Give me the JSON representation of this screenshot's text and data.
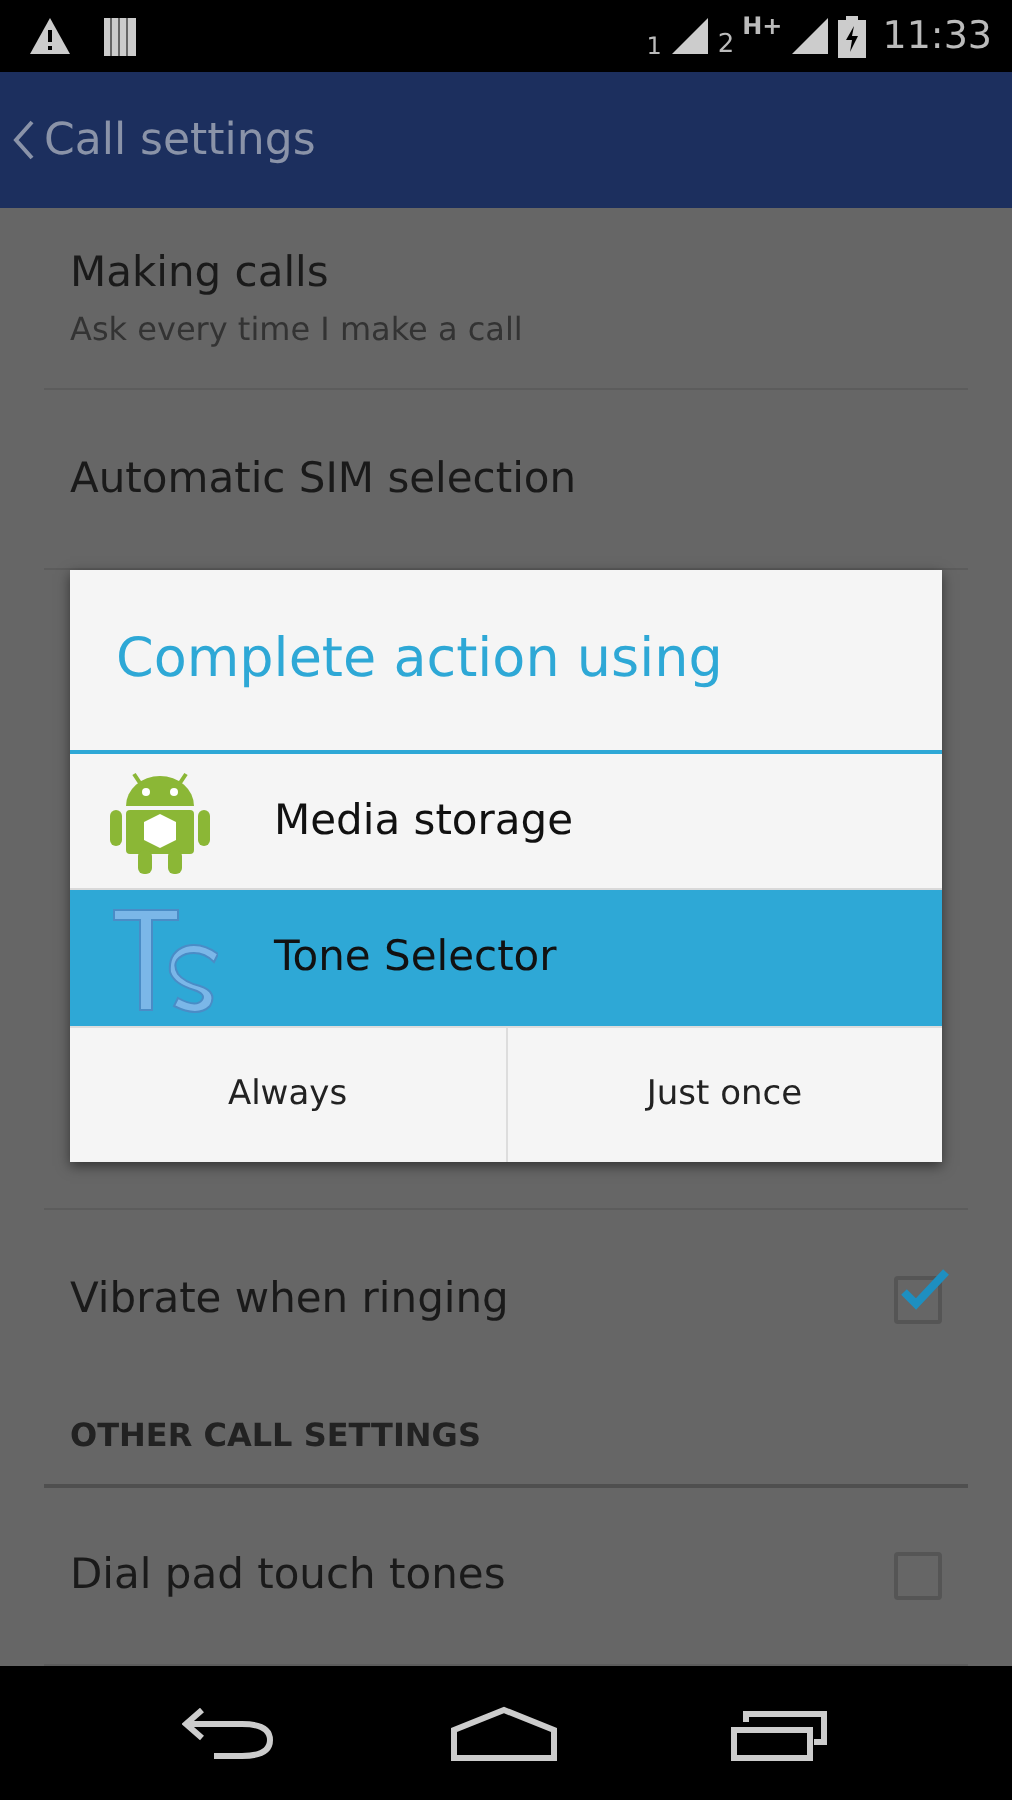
{
  "status_bar": {
    "sim1_label": "1",
    "sim2_label": "2",
    "network_type": "H+",
    "time": "11:33"
  },
  "app_bar": {
    "title": "Call settings"
  },
  "settings": [
    {
      "kind": "text",
      "title": "Making calls",
      "subtitle": "Ask every time I make a call"
    },
    {
      "kind": "text",
      "title": "Automatic SIM selection"
    },
    {
      "kind": "hidden"
    },
    {
      "kind": "checkbox",
      "title": "Vibrate when ringing",
      "checked": true
    },
    {
      "kind": "header",
      "title": "OTHER CALL SETTINGS"
    },
    {
      "kind": "checkbox",
      "title": "Dial pad touch tones",
      "checked": false
    }
  ],
  "dialog": {
    "title": "Complete action using",
    "apps": [
      {
        "kind": "android",
        "label": "Media storage",
        "selected": false
      },
      {
        "kind": "ts",
        "label": "Tone Selector",
        "selected": true
      }
    ],
    "buttons": [
      "Always",
      "Just once"
    ]
  }
}
